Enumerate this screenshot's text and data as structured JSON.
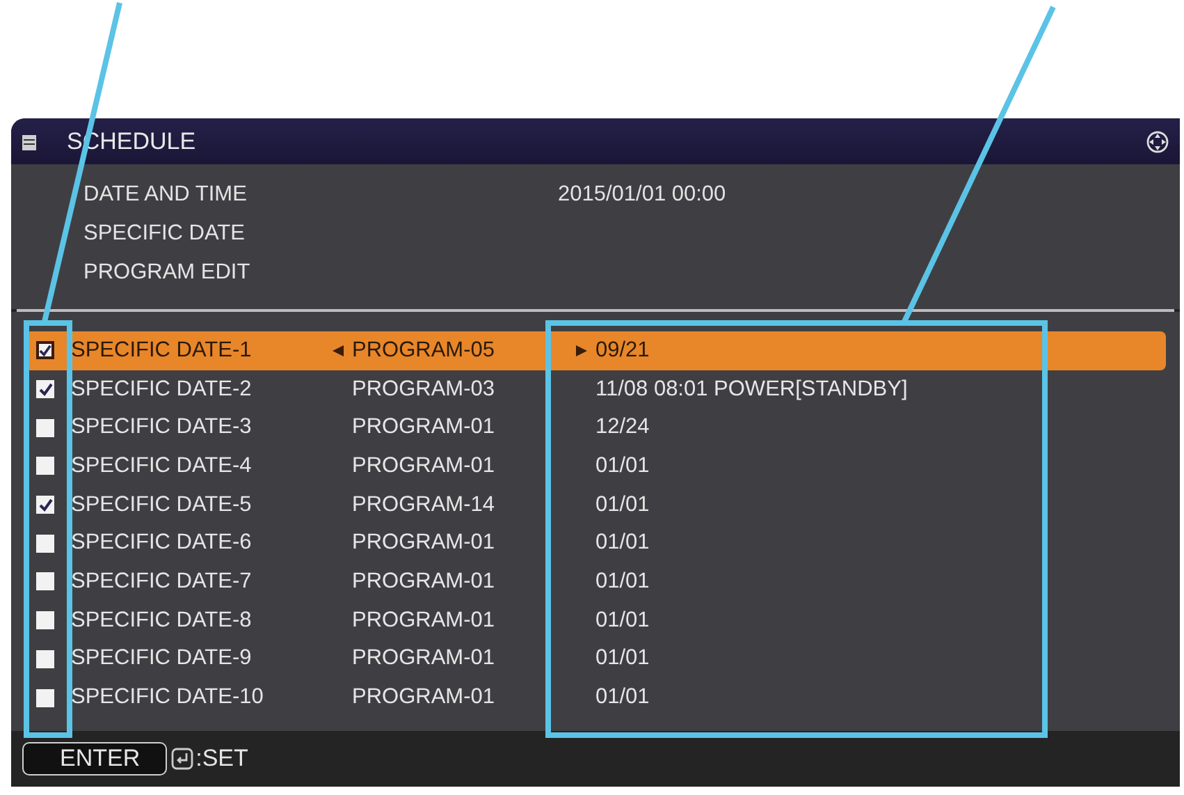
{
  "title": "SCHEDULE",
  "settings": [
    {
      "label": "DATE AND TIME",
      "value": "2015/01/01 00:00"
    },
    {
      "label": "SPECIFIC DATE"
    },
    {
      "label": "PROGRAM EDIT"
    }
  ],
  "rows": [
    {
      "checked": true,
      "selected": true,
      "name": "SPECIFIC DATE-1",
      "program": "PROGRAM-05",
      "date": "09/21"
    },
    {
      "checked": true,
      "selected": false,
      "name": "SPECIFIC DATE-2",
      "program": "PROGRAM-03",
      "date": "11/08 08:01 POWER[STANDBY]"
    },
    {
      "checked": false,
      "selected": false,
      "name": "SPECIFIC DATE-3",
      "program": "PROGRAM-01",
      "date": "12/24"
    },
    {
      "checked": false,
      "selected": false,
      "name": "SPECIFIC DATE-4",
      "program": "PROGRAM-01",
      "date": "01/01"
    },
    {
      "checked": true,
      "selected": false,
      "name": "SPECIFIC DATE-5",
      "program": "PROGRAM-14",
      "date": "01/01"
    },
    {
      "checked": false,
      "selected": false,
      "name": "SPECIFIC DATE-6",
      "program": "PROGRAM-01",
      "date": "01/01"
    },
    {
      "checked": false,
      "selected": false,
      "name": "SPECIFIC DATE-7",
      "program": "PROGRAM-01",
      "date": "01/01"
    },
    {
      "checked": false,
      "selected": false,
      "name": "SPECIFIC DATE-8",
      "program": "PROGRAM-01",
      "date": "01/01"
    },
    {
      "checked": false,
      "selected": false,
      "name": "SPECIFIC DATE-9",
      "program": "PROGRAM-01",
      "date": "01/01"
    },
    {
      "checked": false,
      "selected": false,
      "name": "SPECIFIC DATE-10",
      "program": "PROGRAM-01",
      "date": "01/01"
    }
  ],
  "footer": {
    "button": "ENTER",
    "hint": ":SET"
  }
}
